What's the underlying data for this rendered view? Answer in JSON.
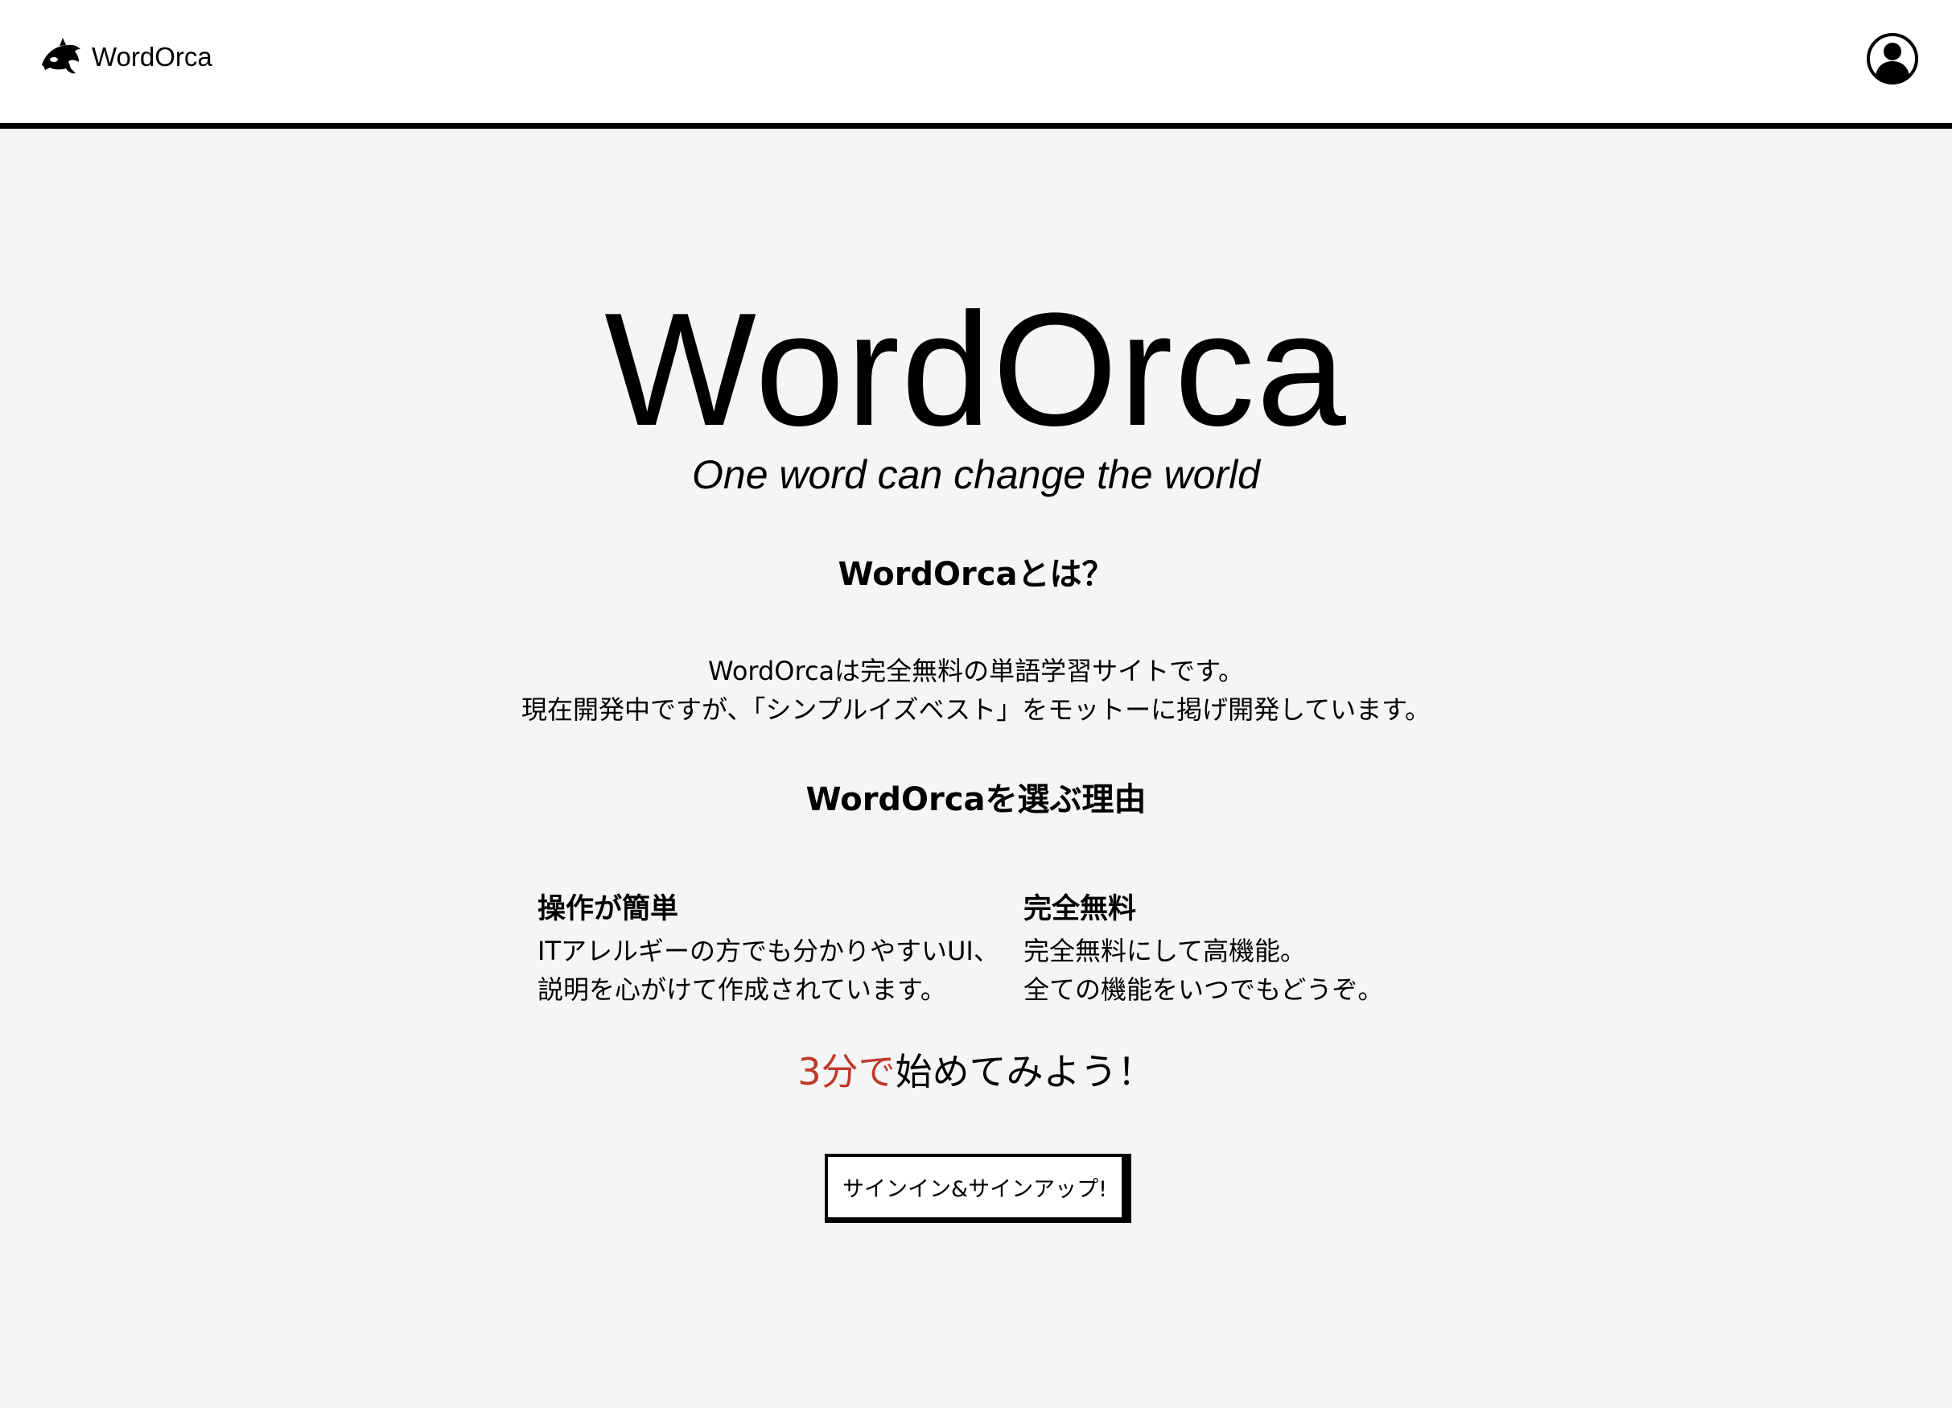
{
  "header": {
    "brand_name": "WordOrca",
    "logo_icon": "orca-icon",
    "account_icon": "user-avatar-icon"
  },
  "hero": {
    "title": "WordOrca",
    "tagline": "One word can change the world"
  },
  "about": {
    "heading": "WordOrcaとは？",
    "lines": [
      "WordOrcaは完全無料の単語学習サイトです。",
      "現在開発中ですが、「シンプルイズベスト」をモットーに掲げ開発しています。"
    ]
  },
  "why": {
    "heading": "WordOrcaを選ぶ理由",
    "reasons": [
      {
        "title": "操作が簡単",
        "lines": [
          "ITアレルギーの方でも分かりやすいUI、",
          "説明を心がけて作成されています。"
        ]
      },
      {
        "title": "完全無料",
        "lines": [
          "完全無料にして高機能。",
          "全ての機能をいつでもどうぞ。"
        ]
      }
    ]
  },
  "cta": {
    "accent": "3分で",
    "text": "始めてみよう！",
    "accent_color": "#c0392b",
    "button_label": "サインイン&サインアップ!"
  }
}
